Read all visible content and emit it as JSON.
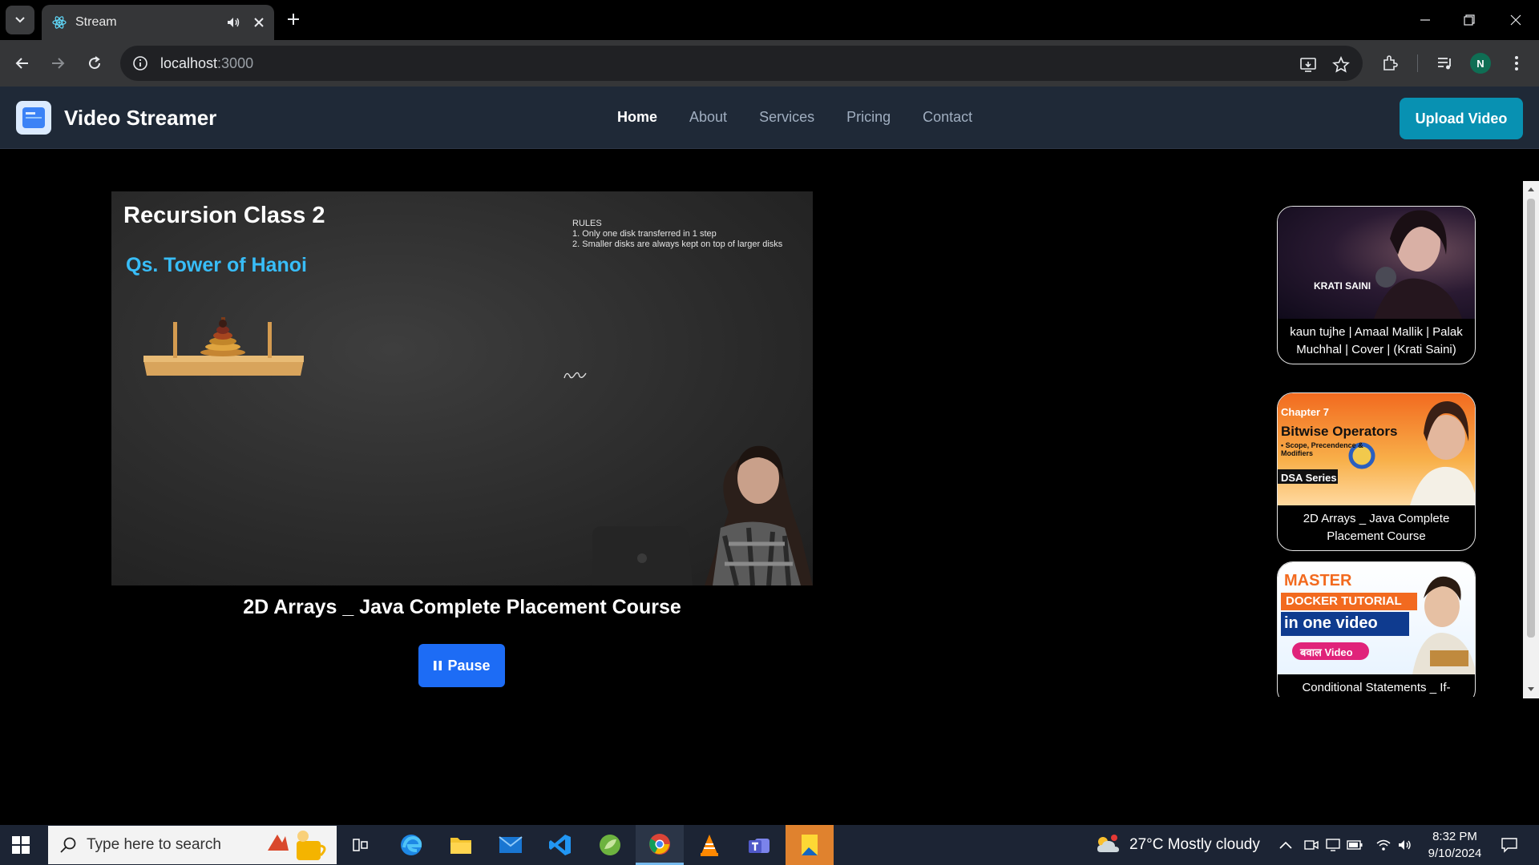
{
  "browser": {
    "tab_title": "Stream",
    "url_host": "localhost",
    "url_port": ":3000",
    "profile_initial": "N"
  },
  "header": {
    "brand": "Video Streamer",
    "nav": [
      "Home",
      "About",
      "Services",
      "Pricing",
      "Contact"
    ],
    "active_nav": "Home",
    "upload_label": "Upload Video"
  },
  "player": {
    "overlay_title": "Recursion Class 2",
    "overlay_subtitle": "Qs. Tower of Hanoi",
    "rules_heading": "RULES",
    "rules": [
      "1. Only one disk transferred in 1 step",
      "2. Smaller disks are always kept on top of larger disks"
    ],
    "caption": "2D Arrays _ Java Complete Placement Course",
    "pause_label": "Pause"
  },
  "playlist": [
    {
      "title": "kaun tujhe | Amaal Mallik | Palak Muchhal | Cover | (Krati Saini)",
      "thumb_text": "KRATI SAINI"
    },
    {
      "title": "2D Arrays _ Java Complete Placement Course",
      "thumb_text_1": "Chapter 7",
      "thumb_text_2": "Bitwise Operators",
      "thumb_text_3": "• Scope, Precendence & Modifiers",
      "thumb_text_4": "DSA Series"
    },
    {
      "title": "Conditional Statements _ If-",
      "thumb_text_1": "MASTER",
      "thumb_text_2": "DOCKER TUTORIAL",
      "thumb_text_3": "in one video",
      "thumb_text_4": "बवाल Video"
    }
  ],
  "taskbar": {
    "search_placeholder": "Type here to search",
    "weather": "27°C  Mostly cloudy",
    "time": "8:32 PM",
    "date": "9/10/2024"
  },
  "colors": {
    "header_bg": "#1f2937",
    "upload_btn": "#0891b2",
    "pause_btn": "#1d6cf5",
    "subtitle": "#38bdf8"
  }
}
